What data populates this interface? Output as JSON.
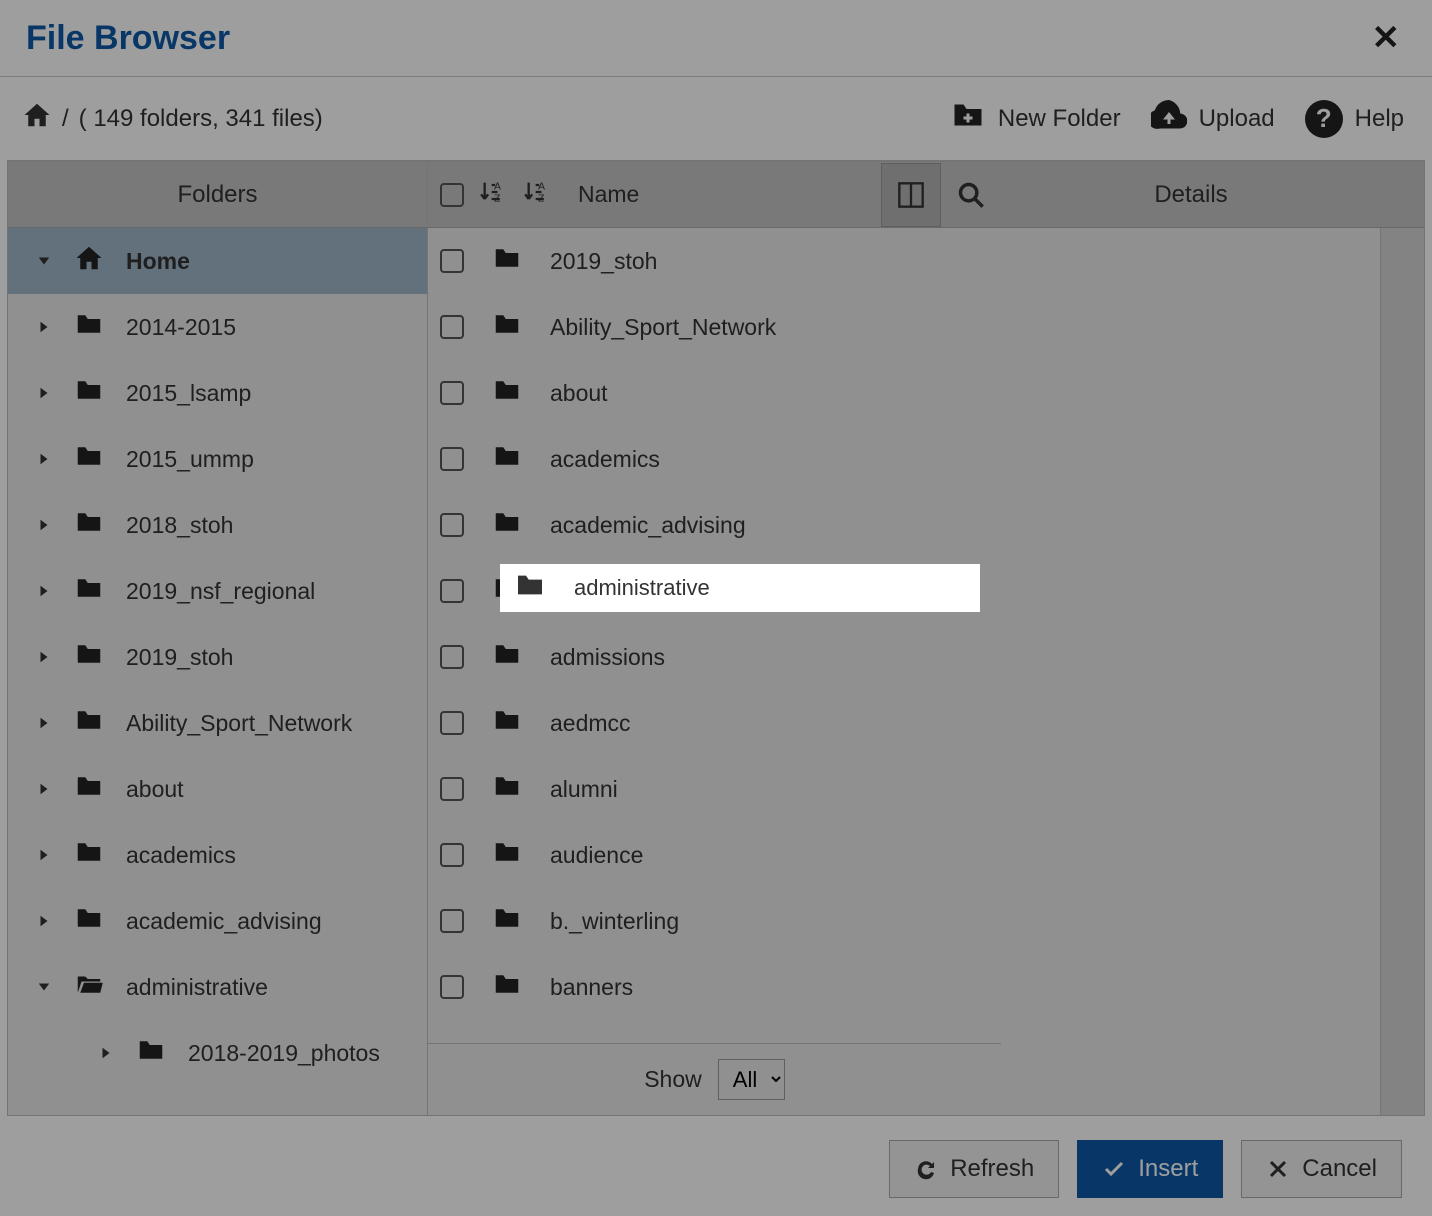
{
  "title": "File Browser",
  "breadcrumb": {
    "separator": "/",
    "summary": "( 149 folders, 341 files)"
  },
  "toolbar": {
    "new_folder": "New Folder",
    "upload": "Upload",
    "help": "Help"
  },
  "panels": {
    "folders_header": "Folders",
    "list_name_header": "Name",
    "details_header": "Details"
  },
  "tree": {
    "home_label": "Home",
    "items": [
      {
        "label": "2014-2015",
        "expanded": false
      },
      {
        "label": "2015_lsamp",
        "expanded": false
      },
      {
        "label": "2015_ummp",
        "expanded": false
      },
      {
        "label": "2018_stoh",
        "expanded": false
      },
      {
        "label": "2019_nsf_regional",
        "expanded": false
      },
      {
        "label": "2019_stoh",
        "expanded": false
      },
      {
        "label": "Ability_Sport_Network",
        "expanded": false
      },
      {
        "label": "about",
        "expanded": false
      },
      {
        "label": "academics",
        "expanded": false
      },
      {
        "label": "academic_advising",
        "expanded": false
      },
      {
        "label": "administrative",
        "expanded": true
      }
    ],
    "child_item": "2018-2019_photos"
  },
  "list": {
    "items": [
      "2019_stoh",
      "Ability_Sport_Network",
      "about",
      "academics",
      "academic_advising",
      "administrative",
      "admissions",
      "aedmcc",
      "alumni",
      "audience",
      "b._winterling",
      "banners"
    ],
    "highlighted_index": 5
  },
  "footer": {
    "show_label": "Show",
    "show_value": "All"
  },
  "buttons": {
    "refresh": "Refresh",
    "insert": "Insert",
    "cancel": "Cancel"
  }
}
